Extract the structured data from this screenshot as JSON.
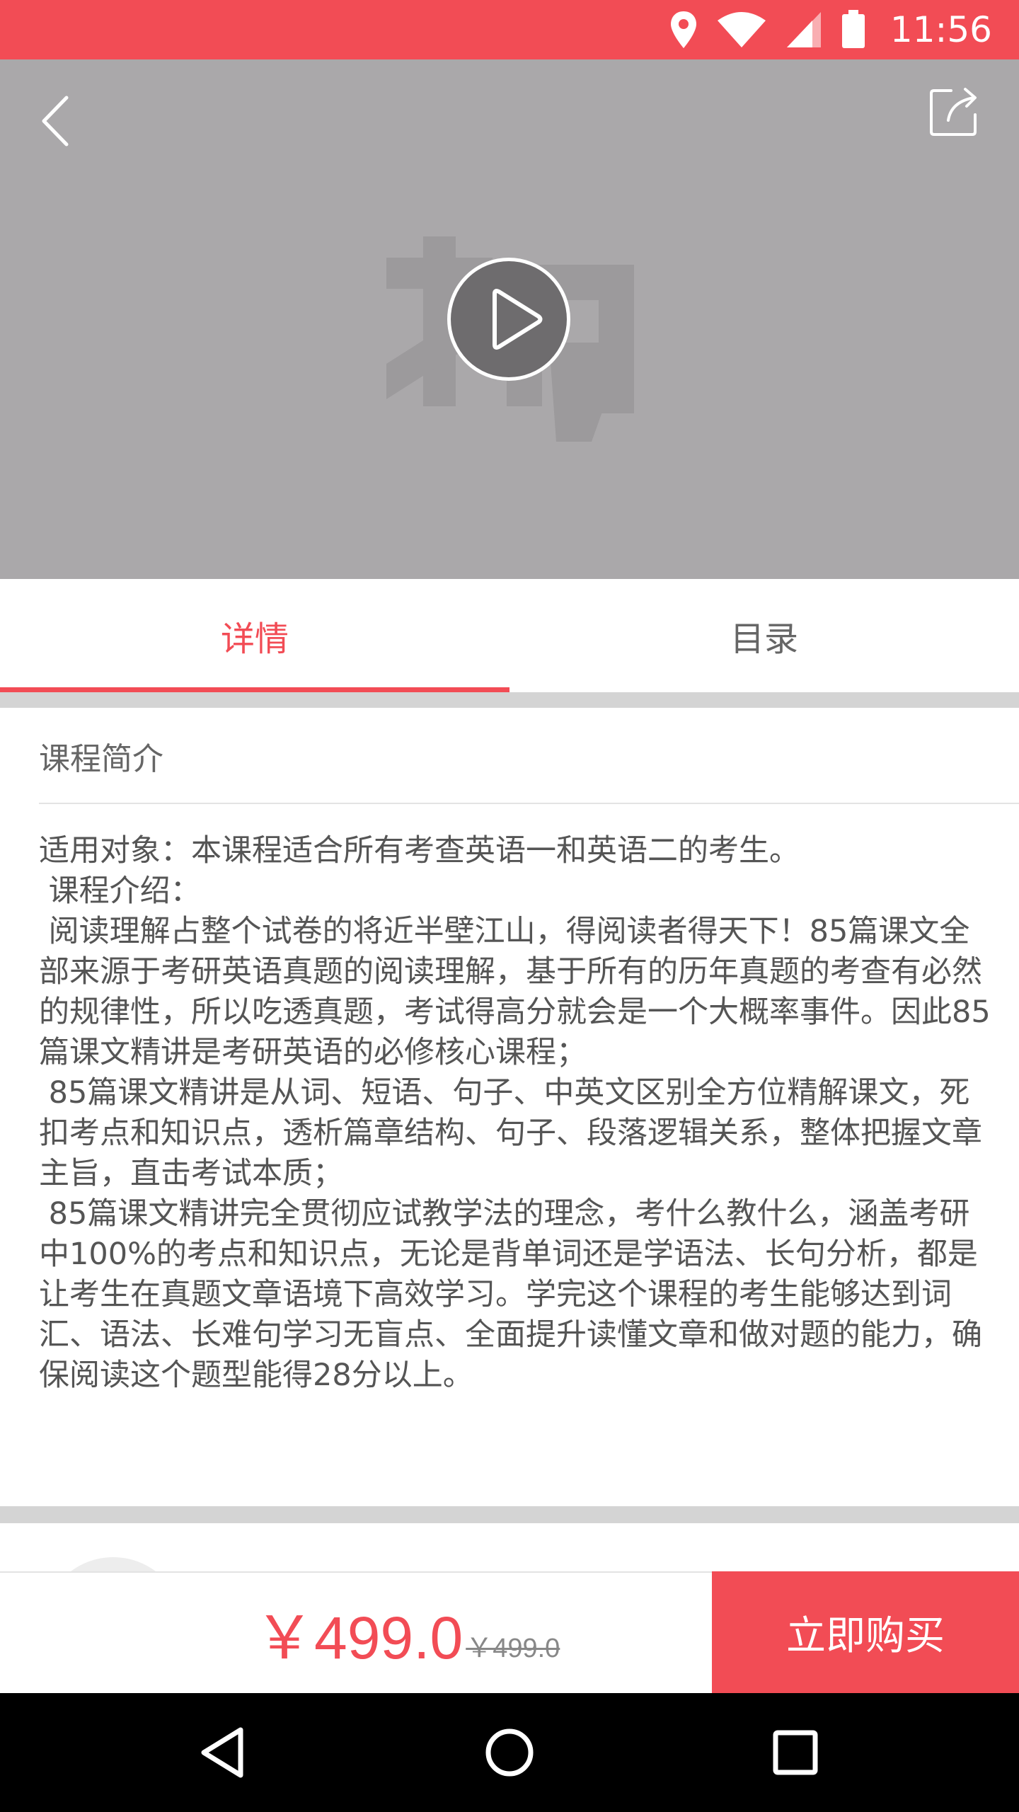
{
  "status_bar": {
    "time": "11:56",
    "icons": [
      "location-icon",
      "wifi-icon",
      "signal-icon",
      "battery-icon"
    ],
    "background": "#f24c55"
  },
  "video": {
    "watermark_logo": "拇",
    "icons": [
      "back-arrow-icon",
      "share-icon",
      "play-icon"
    ]
  },
  "tabs": [
    {
      "label": "详情",
      "active": true
    },
    {
      "label": "目录",
      "active": false
    }
  ],
  "intro": {
    "title": "课程简介",
    "body": "适用对象：本课程适合所有考查英语一和英语二的考生。\n 课程介绍：\n 阅读理解占整个试卷的将近半壁江山，得阅读者得天下！85篇课文全部来源于考研英语真题的阅读理解，基于所有的历年真题的考查有必然的规律性，所以吃透真题，考试得高分就会是一个大概率事件。因此85篇课文精讲是考研英语的必修核心课程；\n 85篇课文精讲是从词、短语、句子、中英文区别全方位精解课文，死扣考点和知识点，透析篇章结构、句子、段落逻辑关系，整体把握文章主旨，直击考试本质；\n 85篇课文精讲完全贯彻应试教学法的理念，考什么教什么，涵盖考研中100%的考点和知识点，无论是背单词还是学语法、长句分析，都是让考生在真题文章语境下高效学习。学完这个课程的考生能够达到词汇、语法、长难句学习无盲点、全面提升读懂文章和做对题的能力，确保阅读这个题型能得28分以上。"
  },
  "purchase": {
    "price": "￥499.0",
    "original_price": "￥499.0",
    "buy_label": "立即购买",
    "accent": "#f24c55"
  },
  "nav_bar": {
    "icons": [
      "nav-back-icon",
      "nav-home-icon",
      "nav-recents-icon"
    ]
  }
}
